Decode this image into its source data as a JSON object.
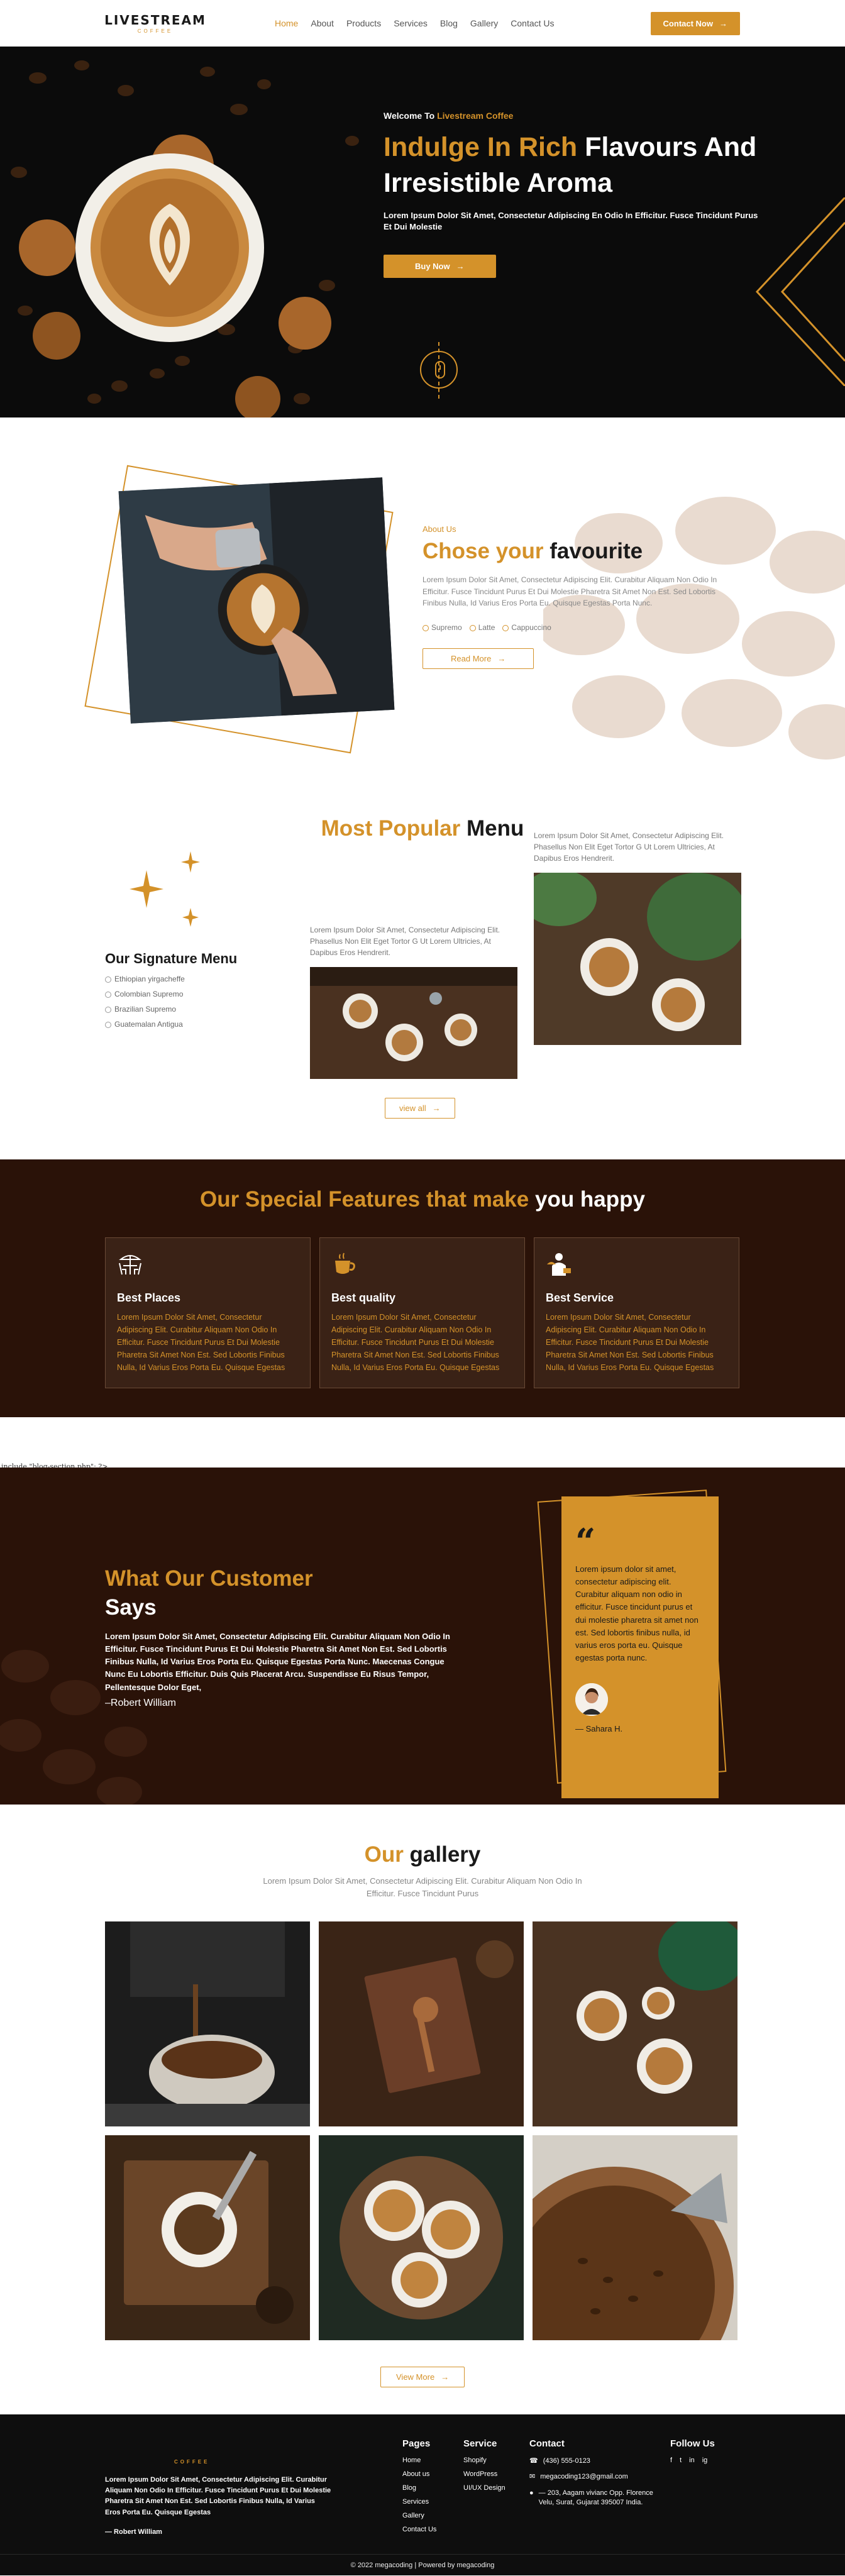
{
  "nav": {
    "logo": "LIVESTREAM",
    "logo_sub": "COFFEE",
    "links": [
      "Home",
      "About",
      "Products",
      "Services",
      "Blog",
      "Gallery",
      "Contact Us"
    ],
    "cta": "Contact Now"
  },
  "hero": {
    "welcome_prefix": "Welcome To ",
    "welcome_brand": "Livestream Coffee",
    "title_accent": "Indulge In Rich",
    "title_rest": " Flavours And Irresistible Aroma",
    "desc": "Lorem Ipsum Dolor Sit Amet, Consectetur Adipiscing En Odio In Efficitur. Fusce Tincidunt Purus Et Dui Molestie",
    "button": "Buy Now"
  },
  "about": {
    "tag": "About Us",
    "title_accent": "Chose your",
    "title_rest": " favourite",
    "desc": "Lorem Ipsum Dolor Sit Amet, Consectetur Adipiscing Elit. Curabitur Aliquam Non Odio In Efficitur. Fusce Tincidunt Purus Et Dui Molestie Pharetra Sit Amet Non Est. Sed Lobortis Finibus Nulla, Id Varius Eros Porta Eu. Quisque Egestas Porta Nunc.",
    "options": [
      "Supremo",
      "Latte",
      "Cappuccino"
    ],
    "button": "Read More"
  },
  "menu": {
    "title_accent": "Most Popular",
    "title_rest": " Menu",
    "signature_title": "Our Signature Menu",
    "signature_items": [
      "Ethiopian yirgacheffe",
      "Colombian Supremo",
      "Brazilian Supremo",
      "Guatemalan Antigua"
    ],
    "card_a_text": "Lorem Ipsum Dolor Sit Amet, Consectetur Adipiscing Elit. Phasellus Non Elit Eget Tortor G Ut Lorem Ultricies, At Dapibus Eros Hendrerit.",
    "card_b_text": "Lorem Ipsum Dolor Sit Amet, Consectetur Adipiscing Elit. Phasellus Non Elit Eget Tortor G Ut Lorem Ultricies, At Dapibus Eros Hendrerit.",
    "button": "view all"
  },
  "features": {
    "title_accent": "Our Special Features that make",
    "title_rest": " you happy",
    "items": [
      {
        "icon": "table-icon",
        "title": "Best Places",
        "desc": "Lorem Ipsum Dolor Sit Amet, Consectetur Adipiscing Elit. Curabitur Aliquam Non Odio In Efficitur. Fusce Tincidunt Purus Et Dui Molestie Pharetra Sit Amet Non Est. Sed Lobortis Finibus Nulla, Id Varius Eros Porta Eu. Quisque Egestas"
      },
      {
        "icon": "cup-icon",
        "title": "Best quality",
        "desc": "Lorem Ipsum Dolor Sit Amet, Consectetur Adipiscing Elit. Curabitur Aliquam Non Odio In Efficitur. Fusce Tincidunt Purus Et Dui Molestie Pharetra Sit Amet Non Est. Sed Lobortis Finibus Nulla, Id Varius Eros Porta Eu. Quisque Egestas"
      },
      {
        "icon": "waiter-icon",
        "title": "Best Service",
        "desc": "Lorem Ipsum Dolor Sit Amet, Consectetur Adipiscing Elit. Curabitur Aliquam Non Odio In Efficitur. Fusce Tincidunt Purus Et Dui Molestie Pharetra Sit Amet Non Est. Sed Lobortis Finibus Nulla, Id Varius Eros Porta Eu. Quisque Egestas"
      }
    ]
  },
  "stray_code": "include \"blog-section.php\"; ?>",
  "testimonial": {
    "title_accent": "What Our Customer",
    "title_rest": "Says",
    "desc": "Lorem Ipsum Dolor Sit Amet, Consectetur Adipiscing Elit. Curabitur Aliquam Non Odio In Efficitur. Fusce Tincidunt Purus Et Dui Molestie Pharetra Sit Amet Non Est. Sed Lobortis Finibus Nulla, Id Varius Eros Porta Eu. Quisque Egestas Porta Nunc. Maecenas Congue Nunc Eu Lobortis Efficitur. Duis Quis Placerat Arcu. Suspendisse Eu Risus Tempor, Pellentesque Dolor Eget,",
    "author": "–Robert William",
    "quote": "Lorem ipsum dolor sit amet, consectetur adipiscing elit. Curabitur aliquam non odio in efficitur. Fusce tincidunt purus et dui molestie pharetra sit amet non est. Sed lobortis finibus nulla, id varius eros porta eu. Quisque egestas porta nunc.",
    "quote_name": "—  Sahara H."
  },
  "gallery": {
    "title_accent": "Our",
    "title_rest": " gallery",
    "sub": "Lorem Ipsum Dolor Sit Amet, Consectetur Adipiscing Elit. Curabitur Aliquam Non Odio In Efficitur. Fusce Tincidunt Purus",
    "button": "View More"
  },
  "footer": {
    "logo_sub": "COFFEE",
    "desc": "Lorem Ipsum Dolor Sit Amet, Consectetur Adipiscing Elit. Curabitur Aliquam Non Odio In Efficitur. Fusce Tincidunt Purus Et Dui Molestie Pharetra Sit Amet Non Est. Sed Lobortis Finibus Nulla, Id Varius Eros Porta Eu. Quisque Egestas",
    "author": "—  Robert William",
    "pages_title": "Pages",
    "pages": [
      "Home",
      "About us",
      "Blog",
      "Services",
      "Gallery",
      "Contact Us"
    ],
    "service_title": "Service",
    "services": [
      "Shopify",
      "WordPress",
      "UI/UX Design"
    ],
    "contact_title": "Contact",
    "phone": "(436) 555-0123",
    "email": "megacoding123@gmail.com",
    "address": "— 203, Aagam vivianc Opp. Florence Velu, Surat, Gujarat 395007 India.",
    "follow_title": "Follow Us",
    "social": [
      "f",
      "t",
      "in",
      "ig"
    ],
    "copyright": "© 2022 megacoding | Powered by megacoding"
  }
}
